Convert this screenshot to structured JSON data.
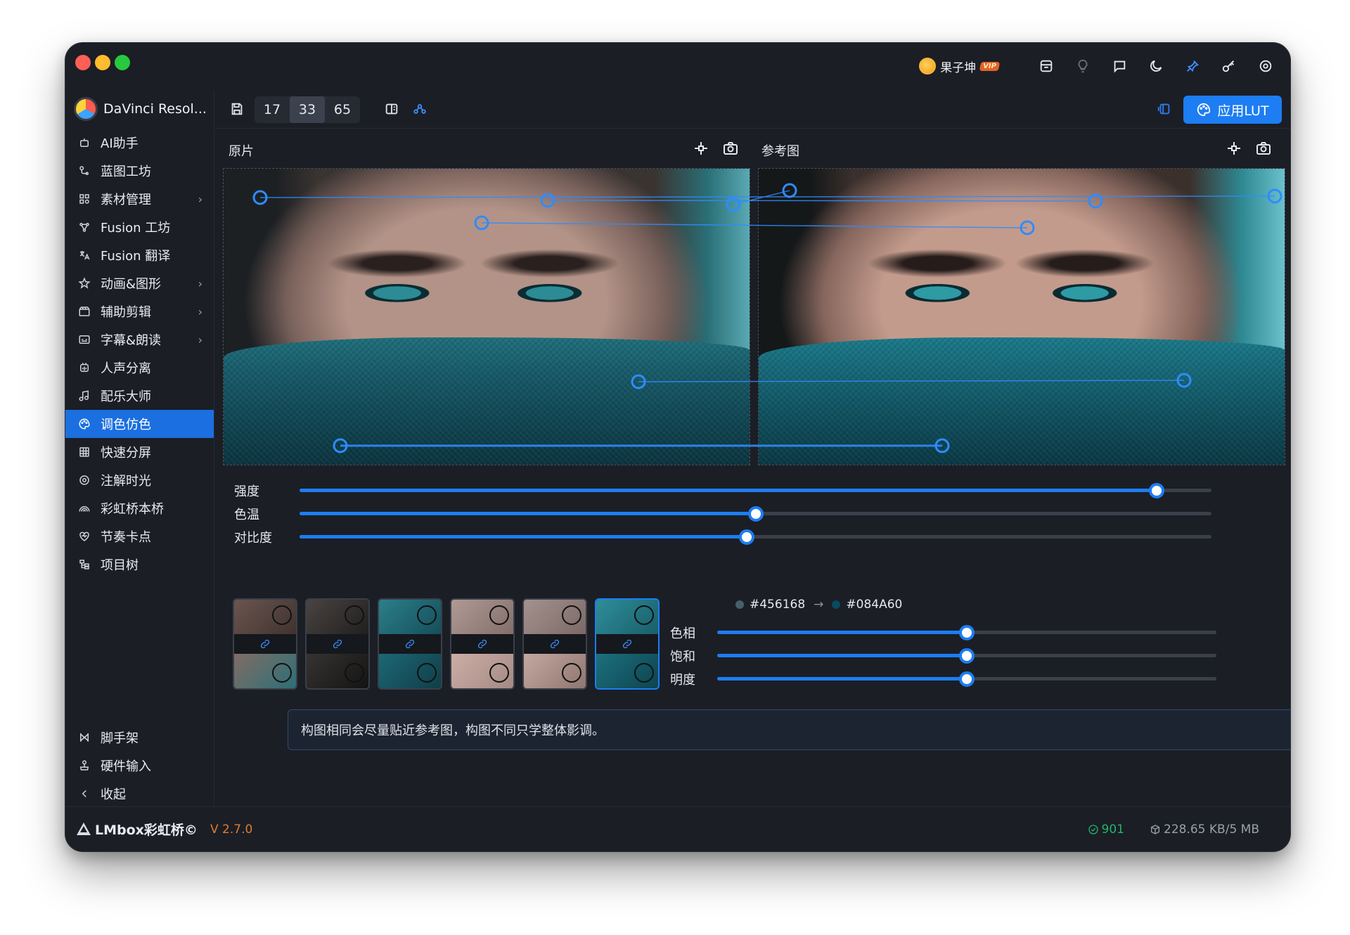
{
  "user": {
    "name": "果子坤",
    "badge": "VIP"
  },
  "toolbar": {
    "segments": [
      "17",
      "33",
      "65"
    ],
    "selected_segment": "33",
    "apply_label": "应用LUT"
  },
  "sidebar": {
    "brand": "DaVinci Resol...",
    "items": [
      {
        "label": "AI助手",
        "icon": "robot-icon"
      },
      {
        "label": "蓝图工坊",
        "icon": "blueprint-icon"
      },
      {
        "label": "素材管理",
        "icon": "assets-icon",
        "has_submenu": true
      },
      {
        "label": "Fusion 工坊",
        "icon": "fusion-icon"
      },
      {
        "label": "Fusion 翻译",
        "icon": "translate-icon"
      },
      {
        "label": "动画&图形",
        "icon": "animation-icon",
        "has_submenu": true
      },
      {
        "label": "辅助剪辑",
        "icon": "clapper-icon",
        "has_submenu": true
      },
      {
        "label": "字幕&朗读",
        "icon": "subtitle-icon",
        "has_submenu": true
      },
      {
        "label": "人声分离",
        "icon": "voice-icon"
      },
      {
        "label": "配乐大师",
        "icon": "music-icon"
      },
      {
        "label": "调色仿色",
        "icon": "palette-icon",
        "active": true
      },
      {
        "label": "快速分屏",
        "icon": "grid-icon"
      },
      {
        "label": "注解时光",
        "icon": "annotation-icon"
      },
      {
        "label": "彩虹桥本桥",
        "icon": "rainbow-icon"
      },
      {
        "label": "节奏卡点",
        "icon": "beat-icon"
      },
      {
        "label": "项目树",
        "icon": "tree-icon"
      }
    ],
    "bottom_items": [
      {
        "label": "脚手架",
        "icon": "scaffold-icon"
      },
      {
        "label": "硬件输入",
        "icon": "joystick-icon"
      },
      {
        "label": "收起",
        "icon": "collapse-icon"
      }
    ]
  },
  "panels": {
    "left_label": "原片",
    "right_label": "参考图"
  },
  "main_sliders": [
    {
      "label": "强度",
      "value": "0.94",
      "fraction": 0.94
    },
    {
      "label": "色温",
      "value": "0.00",
      "fraction": 0.5
    },
    {
      "label": "对比度",
      "value": "0.99",
      "fraction": 0.49
    }
  ],
  "color_match": {
    "from": "#456168",
    "to": "#084A60"
  },
  "hsl_sliders": [
    {
      "label": "色相",
      "value": "0",
      "fraction": 0.5
    },
    {
      "label": "饱和",
      "value": "1.00",
      "fraction": 0.5
    },
    {
      "label": "明度",
      "value": "0.00",
      "fraction": 0.5
    }
  ],
  "hint": "构图相同会尽量贴近参考图，构图不同只学整体影调。",
  "footer": {
    "logo_text": "LMbox彩虹桥©",
    "version": "V 2.7.0",
    "count": "901",
    "storage": "228.65 KB/5 MB"
  },
  "colors": {
    "accent": "#1d7df2",
    "active": "#1b6fe0",
    "version": "#e07b2f",
    "count": "#1fb56b"
  }
}
